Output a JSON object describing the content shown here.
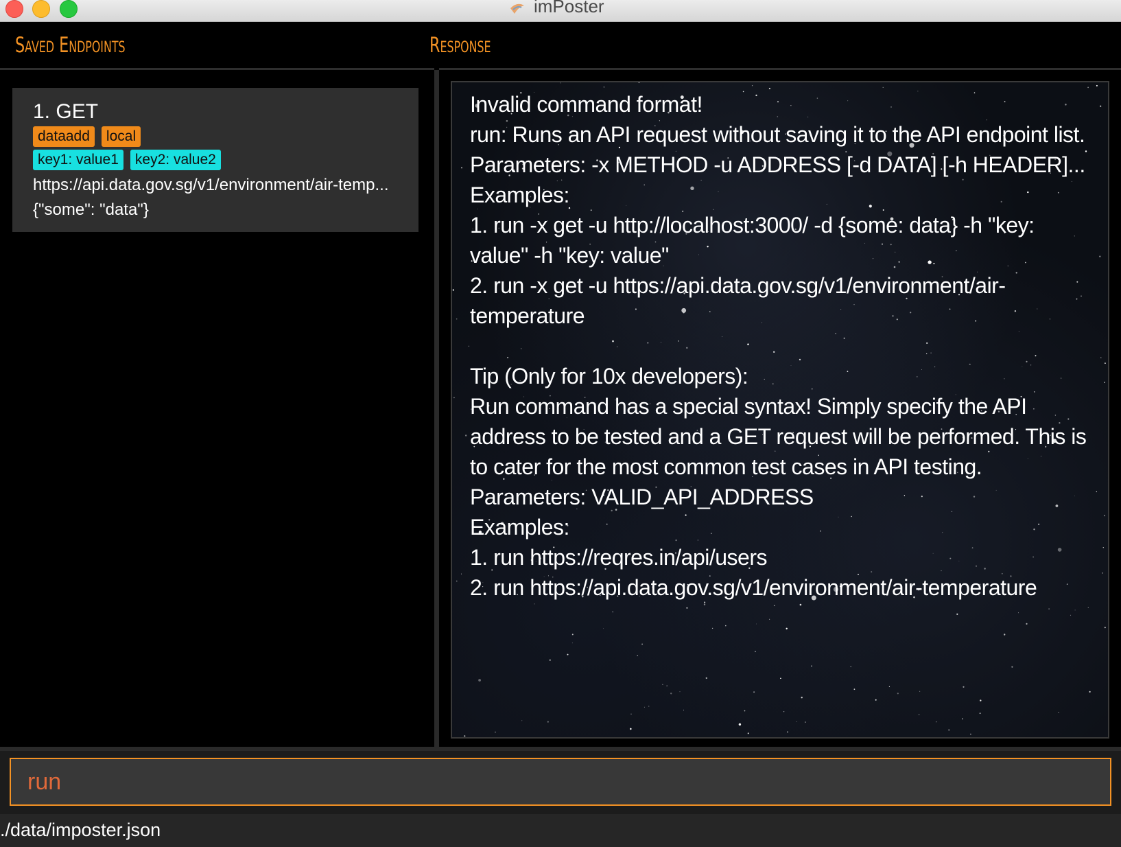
{
  "window": {
    "title": "imPoster"
  },
  "left_panel": {
    "title": "Saved Endpoints",
    "endpoints": [
      {
        "index_method": "1.  GET",
        "tags": [
          "dataadd",
          "local"
        ],
        "headers": [
          "key1: value1",
          "key2: value2"
        ],
        "address": "https://api.data.gov.sg/v1/environment/air-temp...",
        "data": "{\"some\": \"data\"}"
      }
    ]
  },
  "right_panel": {
    "title": "Response",
    "response_text": "Invalid command format!\nrun: Runs an API request without saving it to the API endpoint list.\nParameters: -x METHOD -u ADDRESS [-d DATA] [-h HEADER]...\nExamples:\n1. run -x get -u http://localhost:3000/ -d {some: data} -h \"key: value\" -h \"key: value\"\n2. run -x get -u https://api.data.gov.sg/v1/environment/air-temperature\n\nTip (Only for 10x developers):\nRun command has a special syntax! Simply specify the API address to be tested and a GET request will be performed. This is to cater for the most common test cases in API testing.\nParameters: VALID_API_ADDRESS\nExamples:\n1. run https://reqres.in/api/users\n2. run https://api.data.gov.sg/v1/environment/air-temperature"
  },
  "command_box": {
    "value": "run"
  },
  "status_bar": {
    "file_path": "./data/imposter.json"
  },
  "colors": {
    "accent": "#f39224",
    "tag_orange": "#f08a1a",
    "tag_cyan": "#18e0e0",
    "card_bg": "#2f2f2f",
    "command_text": "#e0693a"
  }
}
